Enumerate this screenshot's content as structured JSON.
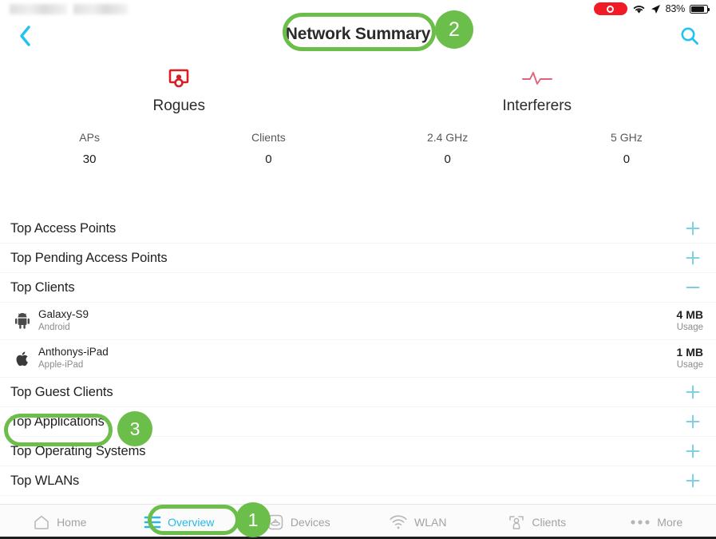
{
  "statusbar": {
    "recording_icon": "record-indicator",
    "wifi_icon": "wifi-icon",
    "location_icon": "location-arrow-icon",
    "battery_percent": "83%",
    "battery_icon": "battery-icon",
    "redacted_left": ""
  },
  "navbar": {
    "back_icon": "chevron-left-icon",
    "title": "Network Summary",
    "search_icon": "search-icon"
  },
  "cards": [
    {
      "icon": "rogue-ap-icon",
      "label": "Rogues"
    },
    {
      "icon": "interference-waveform-icon",
      "label": "Interferers"
    }
  ],
  "stats": [
    {
      "label": "APs",
      "value": "30"
    },
    {
      "label": "Clients",
      "value": "0"
    },
    {
      "label": "2.4 GHz",
      "value": "0"
    },
    {
      "label": "5 GHz",
      "value": "0"
    }
  ],
  "list": [
    {
      "title": "Top Access Points",
      "toggle": "plus-icon"
    },
    {
      "title": "Top Pending Access Points",
      "toggle": "plus-icon"
    },
    {
      "title": "Top Clients",
      "toggle": "minus-icon"
    }
  ],
  "clients": [
    {
      "icon": "android-icon",
      "name": "Galaxy-S9",
      "sub": "Android",
      "usage_value": "4 MB",
      "usage_label": "Usage"
    },
    {
      "icon": "apple-icon",
      "name": "Anthonys-iPad",
      "sub": "Apple-iPad",
      "usage_value": "1 MB",
      "usage_label": "Usage"
    }
  ],
  "list2": [
    {
      "title": "Top Guest Clients",
      "toggle": "plus-icon"
    },
    {
      "title": "Top Applications",
      "toggle": "plus-icon"
    },
    {
      "title": "Top Operating Systems",
      "toggle": "plus-icon"
    },
    {
      "title": "Top WLANs",
      "toggle": "plus-icon"
    }
  ],
  "tabs": [
    {
      "label": "Home",
      "icon": "home-icon",
      "active": false
    },
    {
      "label": "Overview",
      "icon": "menu-lines-icon",
      "active": true
    },
    {
      "label": "Devices",
      "icon": "devices-icon",
      "active": false
    },
    {
      "label": "WLAN",
      "icon": "wifi-icon",
      "active": false
    },
    {
      "label": "Clients",
      "icon": "clients-icon",
      "active": false
    },
    {
      "label": "More",
      "icon": "ellipsis-icon",
      "active": false
    }
  ],
  "annotations": [
    {
      "id": "title",
      "badge": "2",
      "target": "Network Summary"
    },
    {
      "id": "apps",
      "badge": "3",
      "target": "Top Applications"
    },
    {
      "id": "overview",
      "badge": "1",
      "target": "Overview"
    }
  ],
  "colors": {
    "accent_blue": "#26b9e8",
    "toggle_blue": "#7fcfe5",
    "annotation_green": "#6cbe4a",
    "rogue_red": "#d81f26",
    "interferer_pink": "#e0637a",
    "text_primary": "#1f1f1f",
    "text_secondary": "#8b8b8b"
  }
}
